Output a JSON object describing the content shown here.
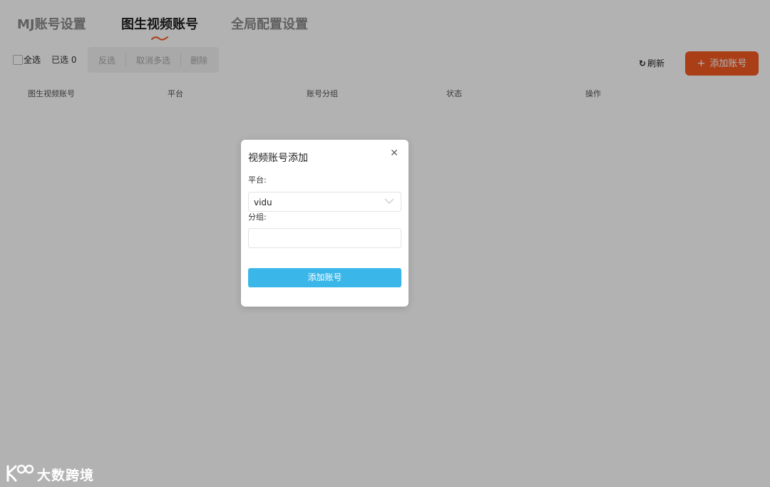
{
  "tabs": [
    {
      "label": "MJ账号设置",
      "active": false
    },
    {
      "label": "图生视频账号",
      "active": true
    },
    {
      "label": "全局配置设置",
      "active": false
    }
  ],
  "toolbar": {
    "select_all": "全选",
    "selected_count": "已选 0",
    "invert": "反选",
    "cancel_multi": "取消多选",
    "delete": "删除",
    "refresh": "刷新",
    "add_account": "添加账号"
  },
  "table": {
    "columns": [
      "图生视频账号",
      "平台",
      "账号分组",
      "状态",
      "操作"
    ]
  },
  "dialog": {
    "title": "视频账号添加",
    "platform_label": "平台:",
    "platform_value": "vidu",
    "group_label": "分组:",
    "group_value": "",
    "submit": "添加账号"
  },
  "watermark": {
    "text": "大数跨境"
  },
  "colors": {
    "accent_orange": "#f25a22",
    "submit_blue": "#3bb6e8",
    "overlay": "rgba(0,0,0,0.30)"
  }
}
